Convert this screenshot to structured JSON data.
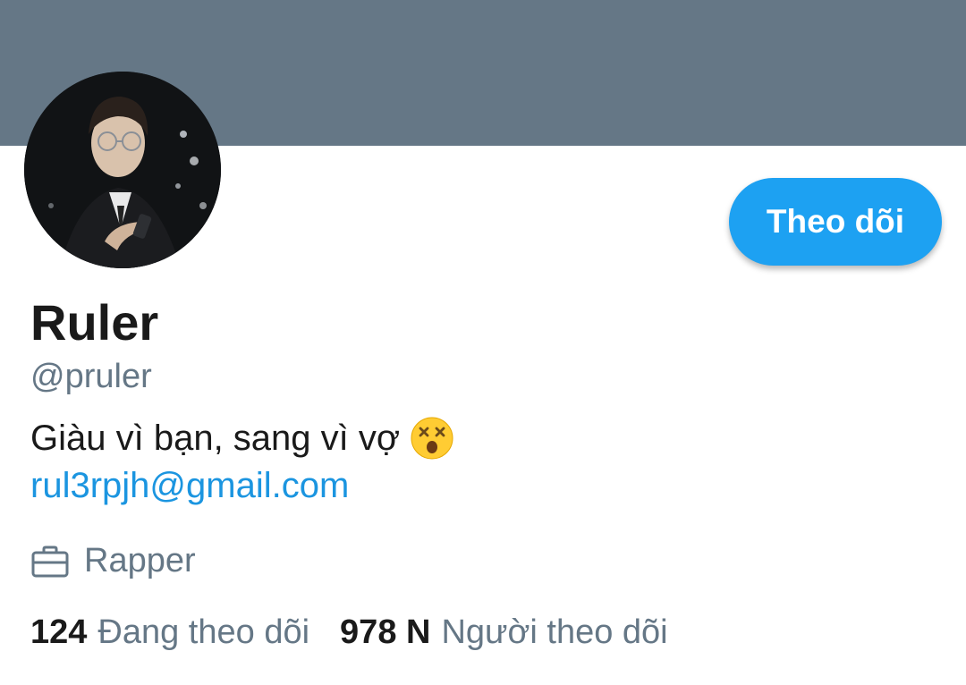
{
  "profile": {
    "name": "Ruler",
    "handle": "@pruler",
    "bio": "Giàu vì bạn, sang vì vợ",
    "bio_emoji": "dizzy-face-emoji",
    "email": "rul3rpjh@gmail.com",
    "occupation": "Rapper",
    "occupation_icon": "briefcase-icon"
  },
  "actions": {
    "follow_label": "Theo dõi"
  },
  "stats": {
    "following_count": "124",
    "following_label": "Đang theo dõi",
    "followers_count": "978 N",
    "followers_label": "Người theo dõi"
  },
  "colors": {
    "banner": "#657786",
    "accent": "#1da1f2",
    "link": "#1b95e0",
    "secondary_text": "#657786"
  }
}
